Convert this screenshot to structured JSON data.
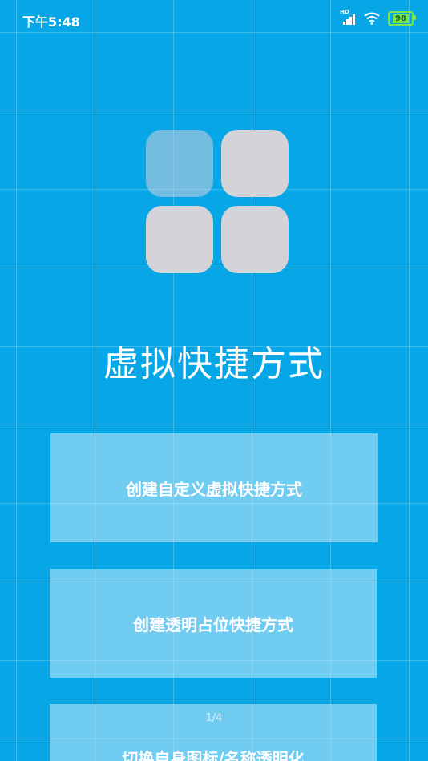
{
  "status_bar": {
    "time": "下午5:48",
    "network_label": "HD",
    "battery": "98",
    "battery_color": "#7ee34a"
  },
  "app": {
    "title": "虚拟快捷方式"
  },
  "actions": [
    {
      "label": "创建自定义虚拟快捷方式"
    },
    {
      "label": "创建透明占位快捷方式"
    },
    {
      "label": "切换自身图标/名称透明化"
    }
  ],
  "page_indicator": "1/4",
  "colors": {
    "background": "#07a6e6",
    "tile": "#d4d3d8"
  }
}
